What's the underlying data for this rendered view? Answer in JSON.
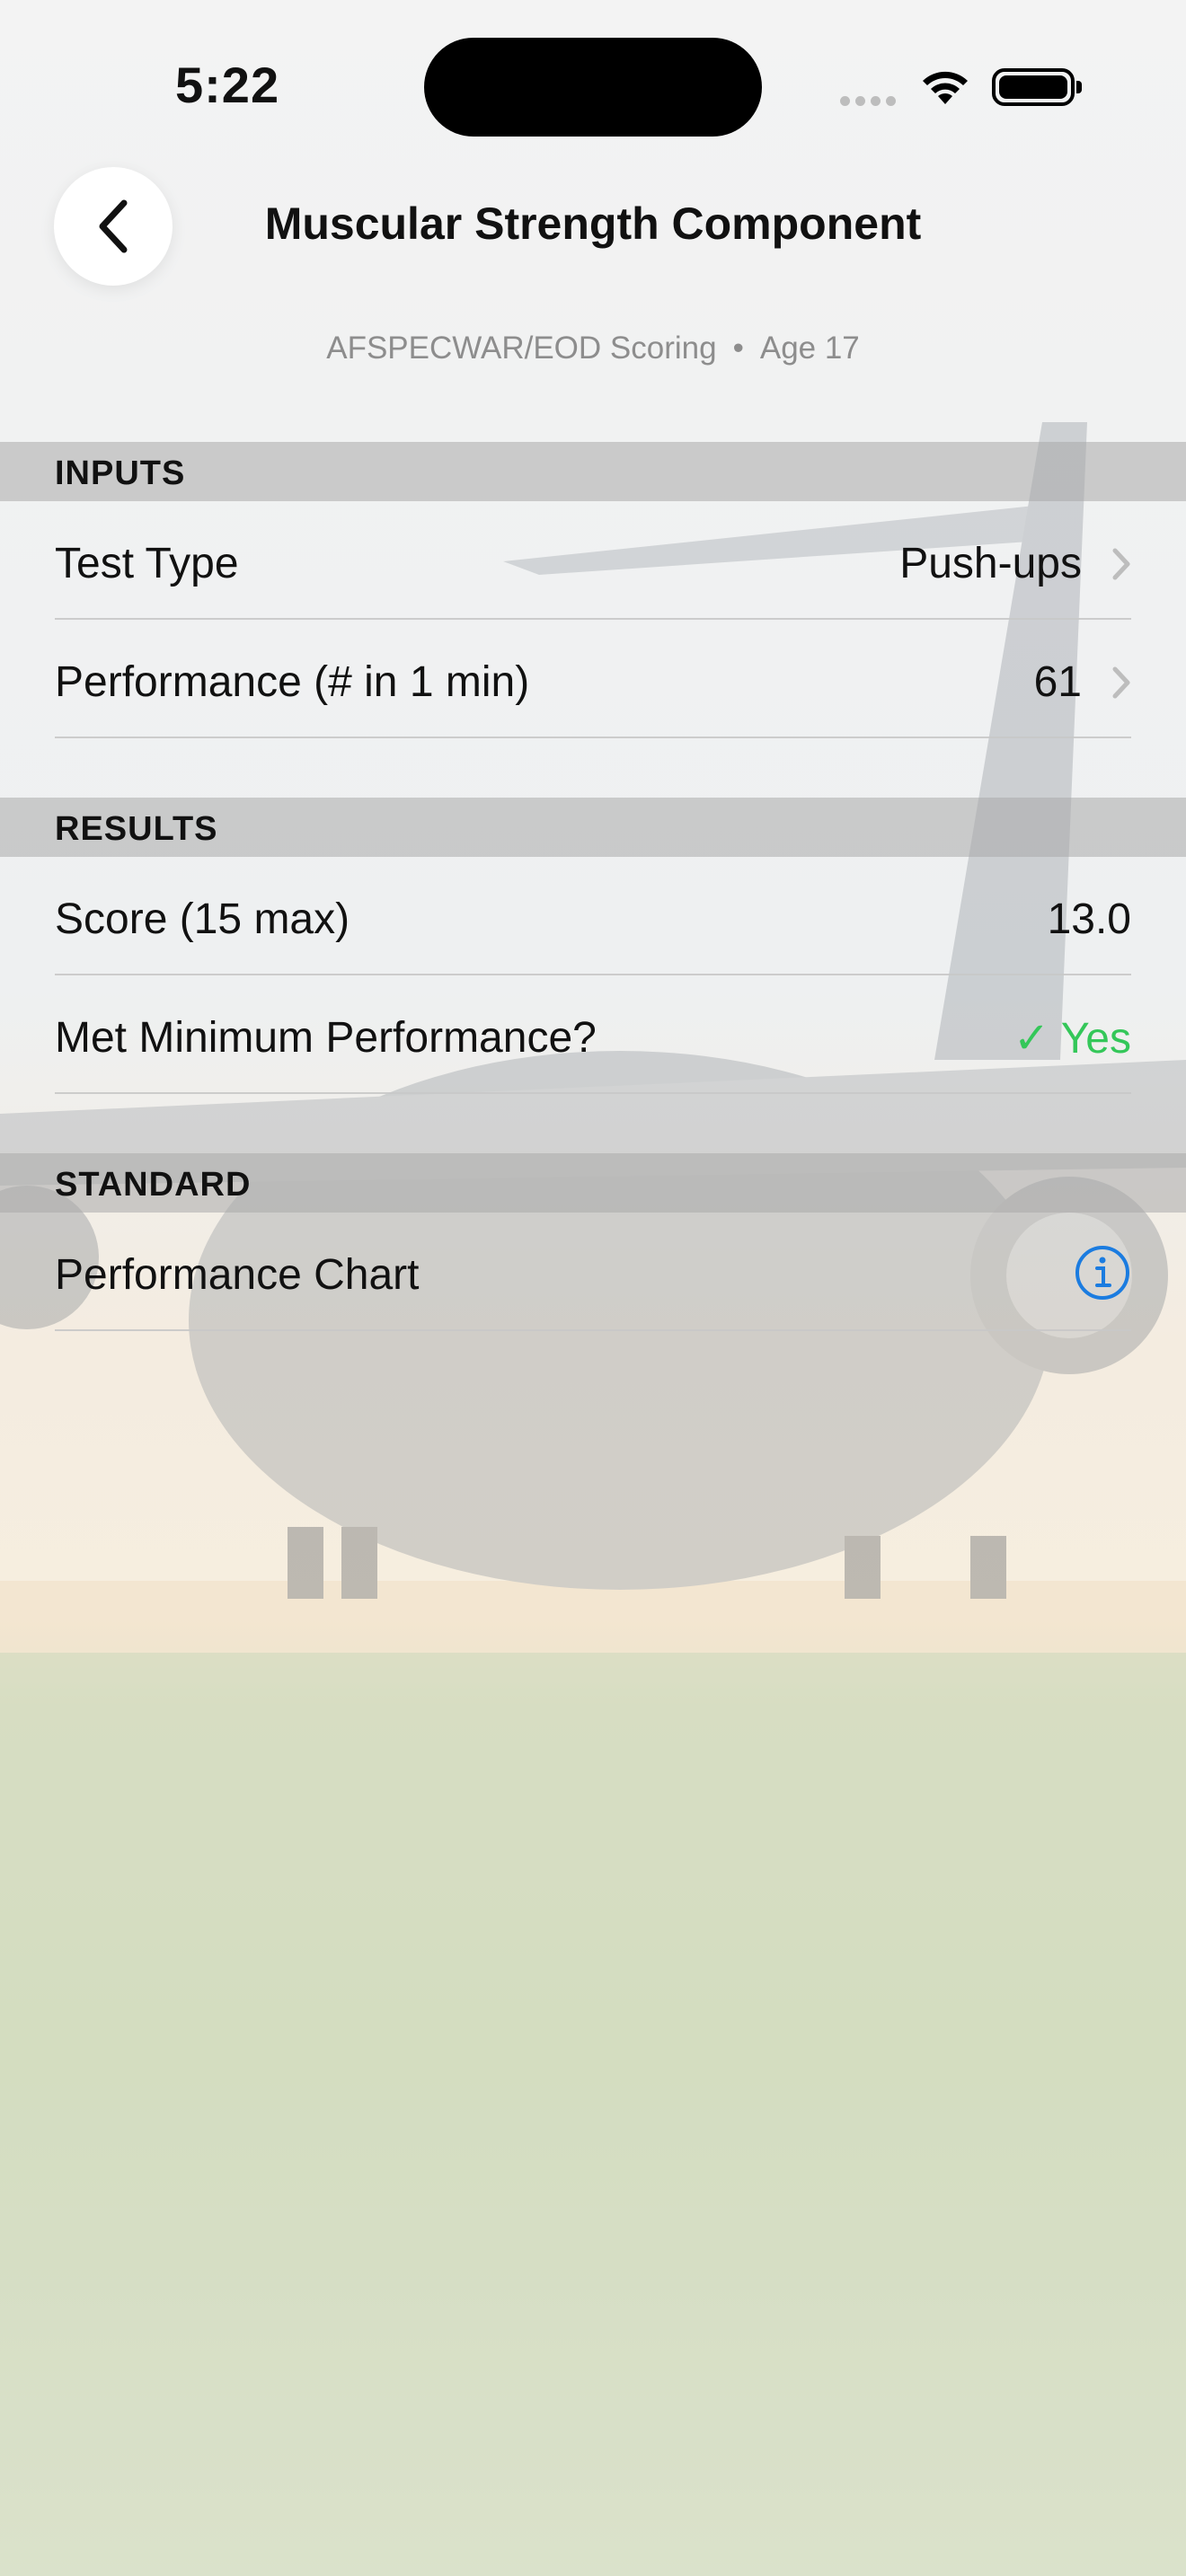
{
  "status_bar": {
    "time": "5:22"
  },
  "header": {
    "title": "Muscular Strength Component",
    "scoring": "AFSPECWAR/EOD Scoring",
    "separator": "•",
    "age": "Age 17"
  },
  "sections": {
    "inputs": {
      "title": "INPUTS",
      "test_type": {
        "label": "Test Type",
        "value": "Push-ups"
      },
      "performance": {
        "label": "Performance (# in 1 min)",
        "value": "61"
      }
    },
    "results": {
      "title": "RESULTS",
      "score": {
        "label": "Score (15 max)",
        "value": "13.0"
      },
      "met_minimum": {
        "label": "Met Minimum Performance?",
        "check": "✓",
        "value": "Yes"
      }
    },
    "standard": {
      "title": "STANDARD",
      "chart": {
        "label": "Performance Chart"
      }
    }
  },
  "colors": {
    "accent": "#1b7ce0",
    "success": "#34c759",
    "section_bg": "#aaaaaa"
  },
  "icons": [
    "back-chevron-icon",
    "wifi-icon",
    "battery-icon",
    "chevron-right-icon",
    "info-icon"
  ]
}
